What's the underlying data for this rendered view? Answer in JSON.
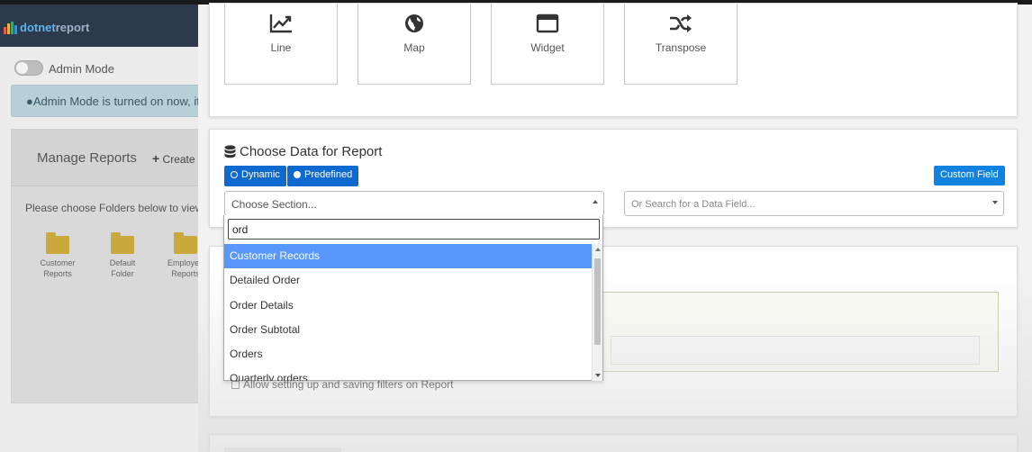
{
  "app": {
    "logo_prefix": "dotnet",
    "logo_suffix": "report",
    "logo_bar_colors": [
      "#e65a4a",
      "#f0b43c",
      "#3aa876",
      "#3a8fd8"
    ]
  },
  "admin": {
    "label": "Admin Mode",
    "alert": "Admin Mode is turned on now, it"
  },
  "manage": {
    "title": "Manage Reports",
    "create": "Create",
    "choose_folders": "Please choose Folders below to view",
    "folders": [
      {
        "line1": "Customer",
        "line2": "Reports"
      },
      {
        "line1": "Default",
        "line2": "Folder"
      },
      {
        "line1": "Employee",
        "line2": "Reports"
      }
    ],
    "folder_color": "#c9a93b"
  },
  "chart_types": [
    {
      "label": "Line",
      "icon": "line-chart-icon"
    },
    {
      "label": "Map",
      "icon": "globe-icon"
    },
    {
      "label": "Widget",
      "icon": "window-icon"
    },
    {
      "label": "Transpose",
      "icon": "shuffle-icon"
    }
  ],
  "data_section": {
    "title": "Choose Data for Report",
    "dynamic_label": "Dynamic",
    "predefined_label": "Predefined",
    "custom_field_label": "Custom Field",
    "section_placeholder": "Choose Section...",
    "field_placeholder": "Or Search for a Data Field...",
    "accent_color": "#0f6ad0"
  },
  "dropdown": {
    "search_value": "ord",
    "options": [
      "Customer Records",
      "Detailed Order",
      "Order Details",
      "Order Subtotal",
      "Orders",
      "Quarterly orders"
    ],
    "active_index": 0,
    "active_color": "#5897fb"
  },
  "filters": {
    "allow_label": "Allow setting up and saving filters on Report"
  }
}
